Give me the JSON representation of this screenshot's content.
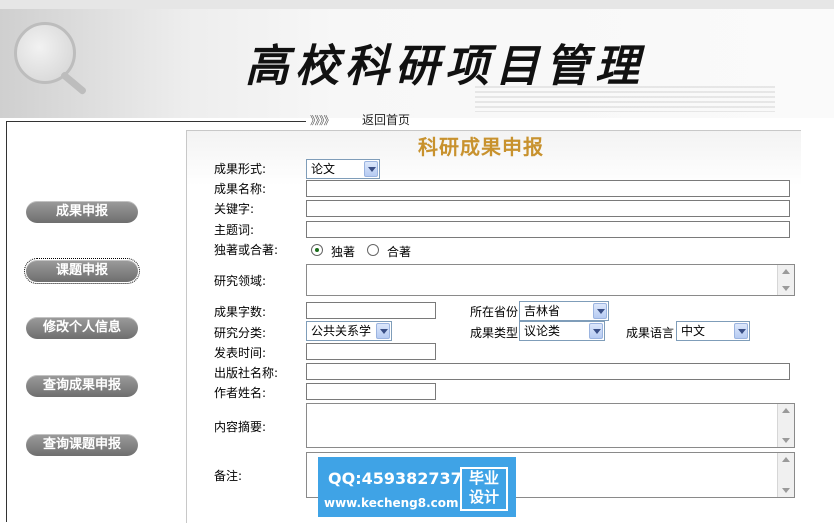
{
  "header": {
    "title": "高校科研项目管理"
  },
  "nav": {
    "arrows": "》》》》",
    "home_link": "返回首页"
  },
  "sidebar": {
    "items": [
      {
        "label": "成果申报"
      },
      {
        "label": "课题申报"
      },
      {
        "label": "修改个人信息"
      },
      {
        "label": "查询成果申报"
      },
      {
        "label": "查询课题申报"
      }
    ]
  },
  "form": {
    "title": "科研成果申报",
    "labels": {
      "form_type": "成果形式:",
      "name": "成果名称:",
      "keywords": "关键字:",
      "subject": "主题词:",
      "authorship": "独著或合著:",
      "field": "研究领域:",
      "word_count": "成果字数:",
      "province": "所在省份",
      "category": "研究分类:",
      "result_type": "成果类型",
      "language": "成果语言",
      "publish_time": "发表时间:",
      "publisher": "出版社名称:",
      "author": "作者姓名:",
      "abstract": "内容摘要:",
      "remark": "备注:"
    },
    "values": {
      "form_type": "论文",
      "name": "",
      "keywords": "",
      "subject": "",
      "word_count": "",
      "province": "吉林省",
      "category": "公共关系学",
      "result_type": "议论类",
      "language": "中文",
      "publish_time": "",
      "publisher": "",
      "author": ""
    },
    "authorship_options": [
      {
        "label": "独著",
        "checked": true
      },
      {
        "label": "合著",
        "checked": false
      }
    ]
  },
  "ad": {
    "qq": "QQ:459382737",
    "url": "www.kecheng8.com",
    "badge_line1": "毕业",
    "badge_line2": "设计"
  },
  "colors": {
    "form_title": "#c8922e",
    "ad_background": "#3fa3e6",
    "sidebar_button": "#7a7a7a"
  }
}
